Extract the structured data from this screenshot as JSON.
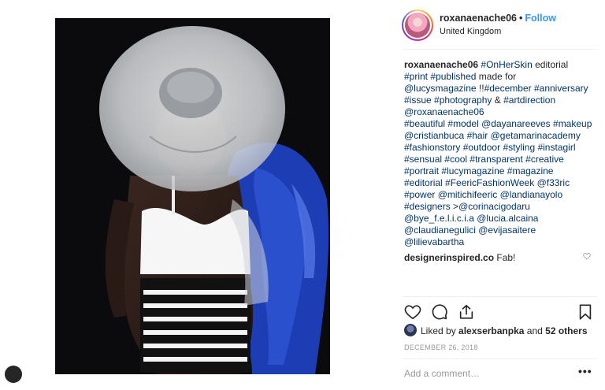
{
  "post": {
    "username": "roxanaenache06",
    "follow_label": "Follow",
    "location": "United Kingdom",
    "photo_alt": "Fashion editorial photo"
  },
  "caption": {
    "owner": "roxanaenache06",
    "lines": [
      [
        {
          "t": "#OnHerSkin",
          "tag": true
        },
        {
          "t": " editorial",
          "tag": false
        }
      ],
      [
        {
          "t": "#print",
          "tag": true
        },
        {
          "t": " ",
          "tag": false
        },
        {
          "t": "#published",
          "tag": true
        },
        {
          "t": " made for",
          "tag": false
        }
      ],
      [
        {
          "t": "@lucysmagazine",
          "tag": true
        },
        {
          "t": " !!",
          "tag": false
        },
        {
          "t": "#december",
          "tag": true
        },
        {
          "t": " ",
          "tag": false
        },
        {
          "t": "#anniversary",
          "tag": true
        }
      ],
      [
        {
          "t": "#issue",
          "tag": true
        },
        {
          "t": " ",
          "tag": false
        },
        {
          "t": "#photography",
          "tag": true
        },
        {
          "t": " & ",
          "tag": false
        },
        {
          "t": "#artdirection",
          "tag": true
        }
      ],
      [
        {
          "t": "@roxanaenache06",
          "tag": true
        }
      ],
      [
        {
          "t": "#beautiful",
          "tag": true
        },
        {
          "t": " ",
          "tag": false
        },
        {
          "t": "#model",
          "tag": true
        },
        {
          "t": " ",
          "tag": false
        },
        {
          "t": "@dayanareeves",
          "tag": true
        },
        {
          "t": " ",
          "tag": false
        },
        {
          "t": "#makeup",
          "tag": true
        }
      ],
      [
        {
          "t": "@cristianbuca",
          "tag": true
        },
        {
          "t": " ",
          "tag": false
        },
        {
          "t": "#hair",
          "tag": true
        },
        {
          "t": " ",
          "tag": false
        },
        {
          "t": "@getamarinacademy",
          "tag": true
        }
      ],
      [
        {
          "t": "#fashionstory",
          "tag": true
        },
        {
          "t": " ",
          "tag": false
        },
        {
          "t": "#outdoor",
          "tag": true
        },
        {
          "t": " ",
          "tag": false
        },
        {
          "t": "#styling",
          "tag": true
        },
        {
          "t": " ",
          "tag": false
        },
        {
          "t": "#instagirl",
          "tag": true
        }
      ],
      [
        {
          "t": "#sensual",
          "tag": true
        },
        {
          "t": " ",
          "tag": false
        },
        {
          "t": "#cool",
          "tag": true
        },
        {
          "t": " ",
          "tag": false
        },
        {
          "t": "#transparent",
          "tag": true
        },
        {
          "t": " ",
          "tag": false
        },
        {
          "t": "#creative",
          "tag": true
        }
      ],
      [
        {
          "t": "#portrait",
          "tag": true
        },
        {
          "t": " ",
          "tag": false
        },
        {
          "t": "#lucymagazine",
          "tag": true
        },
        {
          "t": " ",
          "tag": false
        },
        {
          "t": "#magazine",
          "tag": true
        }
      ],
      [
        {
          "t": "#editorial",
          "tag": true
        },
        {
          "t": " ",
          "tag": false
        },
        {
          "t": "#FeericFashionWeek",
          "tag": true
        },
        {
          "t": " ",
          "tag": false
        },
        {
          "t": "@f33ric",
          "tag": true
        }
      ],
      [
        {
          "t": "#power",
          "tag": true
        },
        {
          "t": " ",
          "tag": false
        },
        {
          "t": "@mitichifeeric",
          "tag": true
        },
        {
          "t": " ",
          "tag": false
        },
        {
          "t": "@landianayolo",
          "tag": true
        }
      ],
      [
        {
          "t": "#designers",
          "tag": true
        },
        {
          "t": " >",
          "tag": false
        },
        {
          "t": "@corinacigodaru",
          "tag": true
        }
      ],
      [
        {
          "t": "@bye_f.e.l.i.c.i.a",
          "tag": true
        },
        {
          "t": " ",
          "tag": false
        },
        {
          "t": "@lucia.alcaina",
          "tag": true
        }
      ],
      [
        {
          "t": "@claudianegulici",
          "tag": true
        },
        {
          "t": " ",
          "tag": false
        },
        {
          "t": "@evijasaitere",
          "tag": true
        }
      ],
      [
        {
          "t": "@lilievabartha",
          "tag": true
        }
      ]
    ]
  },
  "comments": [
    {
      "user": "designerinspired.co",
      "text": "Fab!"
    }
  ],
  "likes": {
    "liked_by_prefix": "Liked by",
    "liked_by_user": "alexserbanpka",
    "and_word": "and",
    "others_label": "52 others"
  },
  "date": "DECEMBER 26, 2018",
  "comment_input": {
    "placeholder": "Add a comment…"
  },
  "more_label": "•••",
  "icons": [
    "heart-icon",
    "comment-icon",
    "share-icon",
    "bookmark-icon",
    "small-heart-icon"
  ],
  "colors": {
    "link": "#003569",
    "follow": "#3897f0",
    "text": "#262626",
    "muted": "#999999",
    "blue_feathers": "#1f3fb8"
  }
}
